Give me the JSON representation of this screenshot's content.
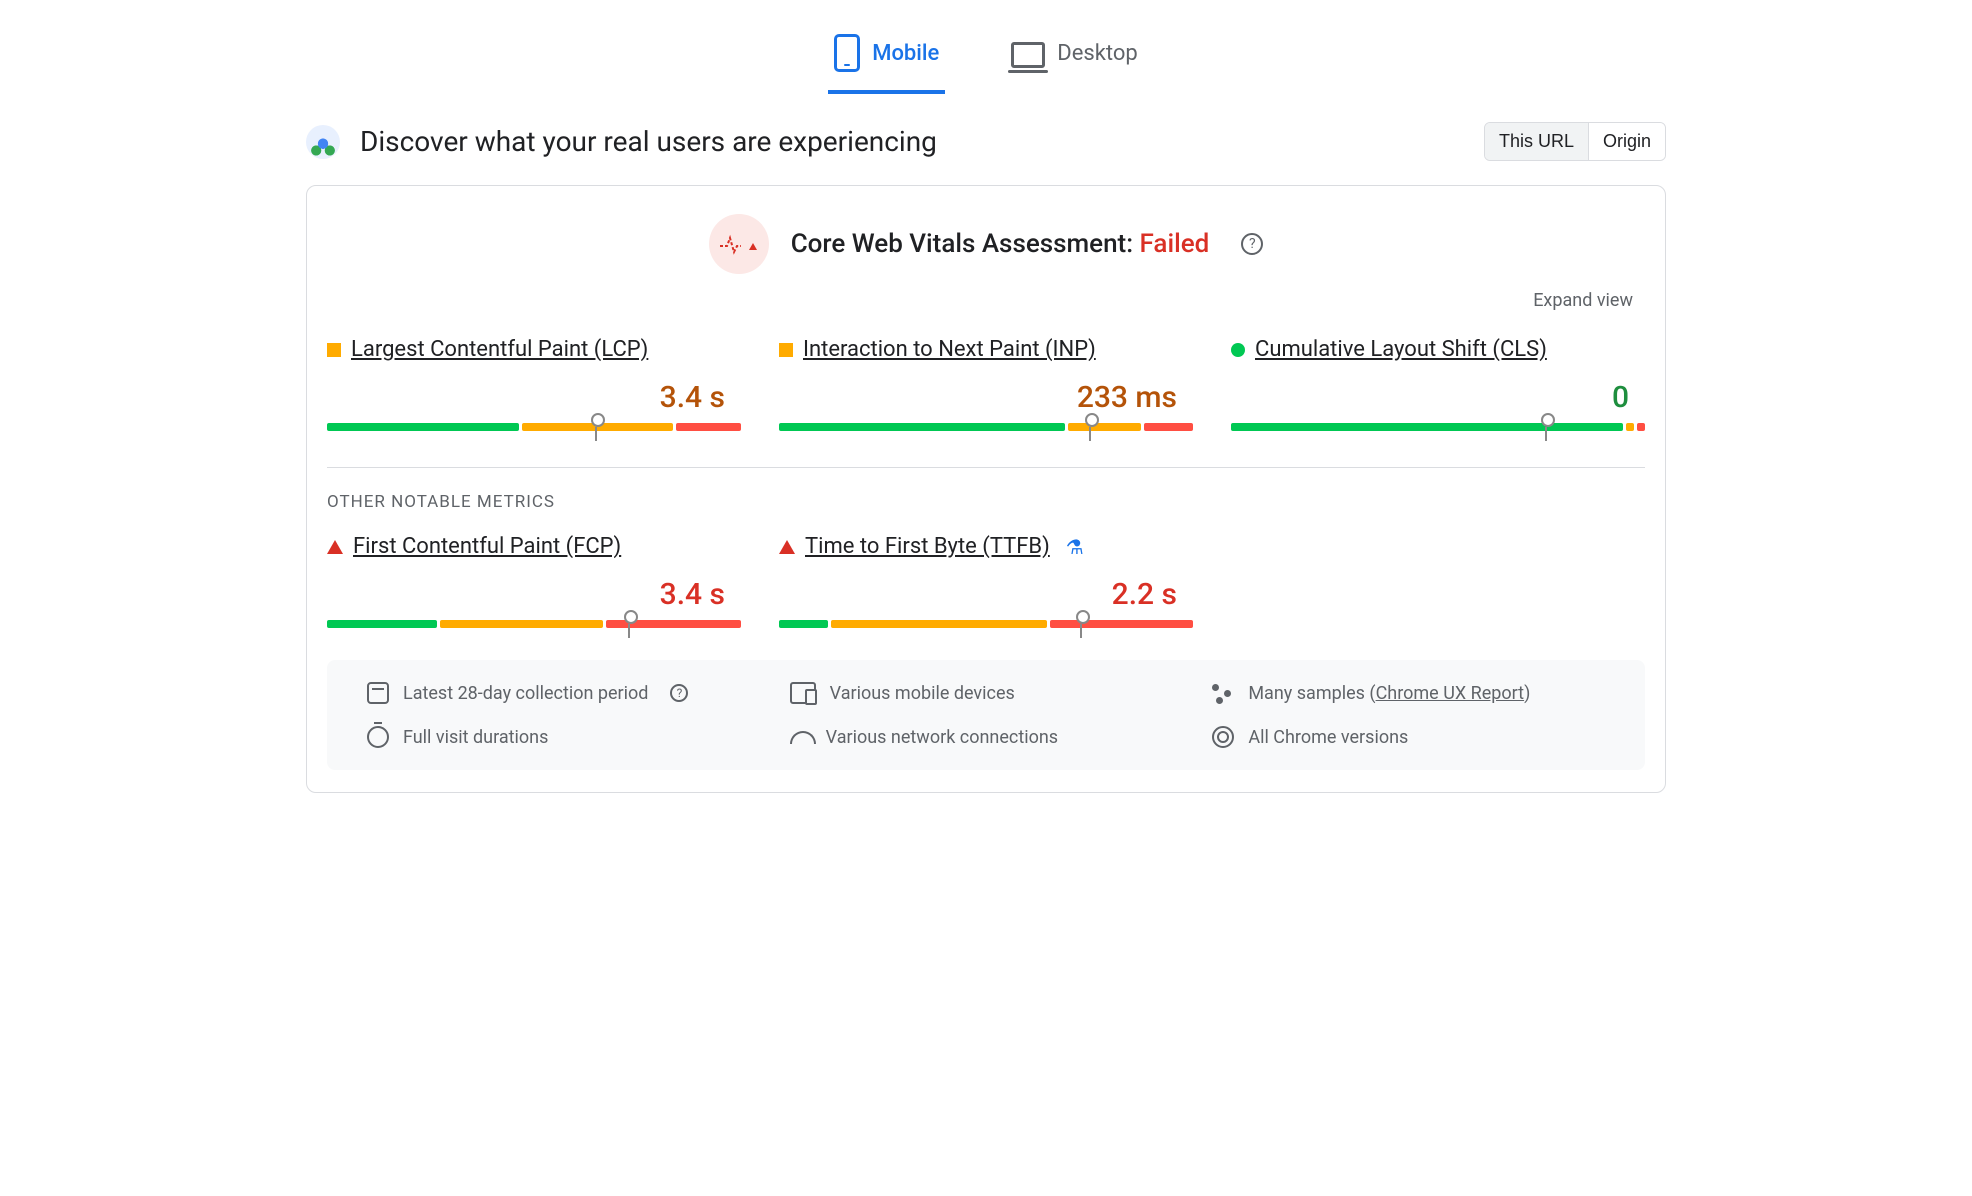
{
  "tabs": {
    "mobile": "Mobile",
    "desktop": "Desktop",
    "active": "mobile"
  },
  "header": {
    "title": "Discover what your real users are experiencing",
    "scope": {
      "this_url": "This URL",
      "origin": "Origin"
    }
  },
  "assessment": {
    "label": "Core Web Vitals Assessment: ",
    "status": "Failed",
    "expand": "Expand view"
  },
  "section_other": "OTHER NOTABLE METRICS",
  "metrics": {
    "lcp": {
      "name": "Largest Contentful Paint (LCP)",
      "value": "3.4 s",
      "status": "warn",
      "bar": {
        "g": 47,
        "y": 37,
        "r": 16,
        "marker": 65
      }
    },
    "inp": {
      "name": "Interaction to Next Paint (INP)",
      "value": "233 ms",
      "status": "warn",
      "bar": {
        "g": 70,
        "y": 18,
        "r": 12,
        "marker": 75
      }
    },
    "cls": {
      "name": "Cumulative Layout Shift (CLS)",
      "value": "0",
      "status": "good",
      "bar": {
        "g": 96,
        "y": 2,
        "r": 2,
        "marker": 76
      }
    },
    "fcp": {
      "name": "First Contentful Paint (FCP)",
      "value": "3.4 s",
      "status": "bad",
      "bar": {
        "g": 27,
        "y": 40,
        "r": 33,
        "marker": 73
      }
    },
    "ttfb": {
      "name": "Time to First Byte (TTFB)",
      "value": "2.2 s",
      "status": "bad",
      "flask": true,
      "bar": {
        "g": 12,
        "y": 53,
        "r": 35,
        "marker": 73
      }
    }
  },
  "footer": {
    "period": "Latest 28-day collection period",
    "durations": "Full visit durations",
    "devices": "Various mobile devices",
    "network": "Various network connections",
    "samples_prefix": "Many samples (",
    "samples_link": "Chrome UX Report",
    "samples_suffix": ")",
    "versions": "All Chrome versions"
  }
}
